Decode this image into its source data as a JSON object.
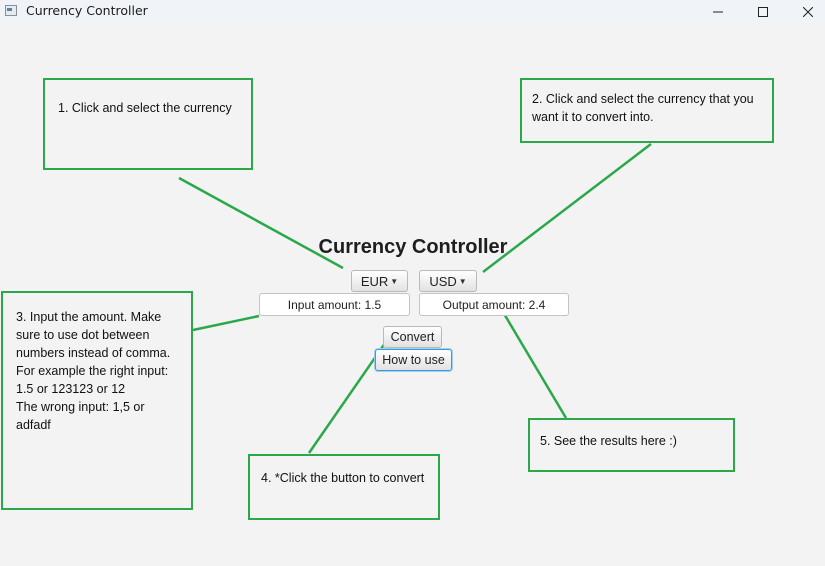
{
  "window": {
    "title": "Currency Controller",
    "controls": [
      "minimize-icon",
      "maximize-icon",
      "close-icon"
    ]
  },
  "app": {
    "heading": "Currency Controller",
    "from_currency": "EUR",
    "to_currency": "USD",
    "input_amount": "Input amount: 1.5",
    "output_amount": "Output amount: 2.4",
    "convert_label": "Convert",
    "howto_label": "How to use"
  },
  "annotations": {
    "step1": "1. Click and select the currency",
    "step2": "2. Click and select the currency that you want it to convert into.",
    "step3_line1": "3. Input the amount. Make sure to use dot between numbers instead of comma. For example the right input: 1.5 or 123123 or 12",
    "step3_line2": "The wrong input: 1,5 or adfadf",
    "step4": "4. *Click the button to convert",
    "step5": "5. See the results here :)"
  },
  "colors": {
    "annotation": "#2aa84a",
    "focus": "#3c9bd6",
    "background": "#f3f3f3"
  }
}
